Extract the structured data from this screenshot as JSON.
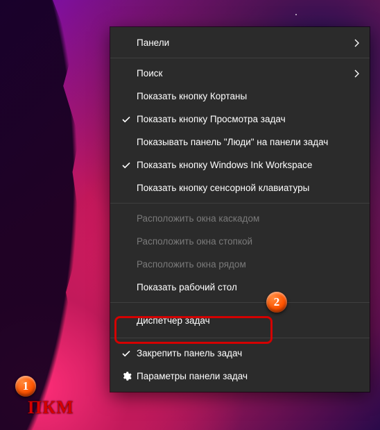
{
  "menu": {
    "panels": {
      "label": "Панели",
      "submenu": true
    },
    "search": {
      "label": "Поиск",
      "submenu": true
    },
    "cortana": {
      "label": "Показать кнопку Кортаны"
    },
    "taskview": {
      "label": "Показать кнопку Просмотра задач",
      "checked": true
    },
    "people": {
      "label": "Показывать панель \"Люди\" на панели задач"
    },
    "ink": {
      "label": "Показать кнопку Windows Ink Workspace",
      "checked": true
    },
    "touchkb": {
      "label": "Показать кнопку сенсорной клавиатуры"
    },
    "cascade": {
      "label": "Расположить окна каскадом",
      "disabled": true
    },
    "stack": {
      "label": "Расположить окна стопкой",
      "disabled": true
    },
    "sidebyside": {
      "label": "Расположить окна рядом",
      "disabled": true
    },
    "showdesk": {
      "label": "Показать рабочий стол"
    },
    "taskmgr": {
      "label": "Диспетчер задач"
    },
    "lock": {
      "label": "Закрепить панель задач",
      "checked": true
    },
    "settings": {
      "label": "Параметры панели задач",
      "icon": "gear"
    }
  },
  "annotations": {
    "badge1": "1",
    "badge2": "2",
    "pkm": "ПКМ"
  },
  "colors": {
    "menu_bg": "#2b2b2b",
    "highlight": "#d40000",
    "badge": "#ff5400"
  }
}
